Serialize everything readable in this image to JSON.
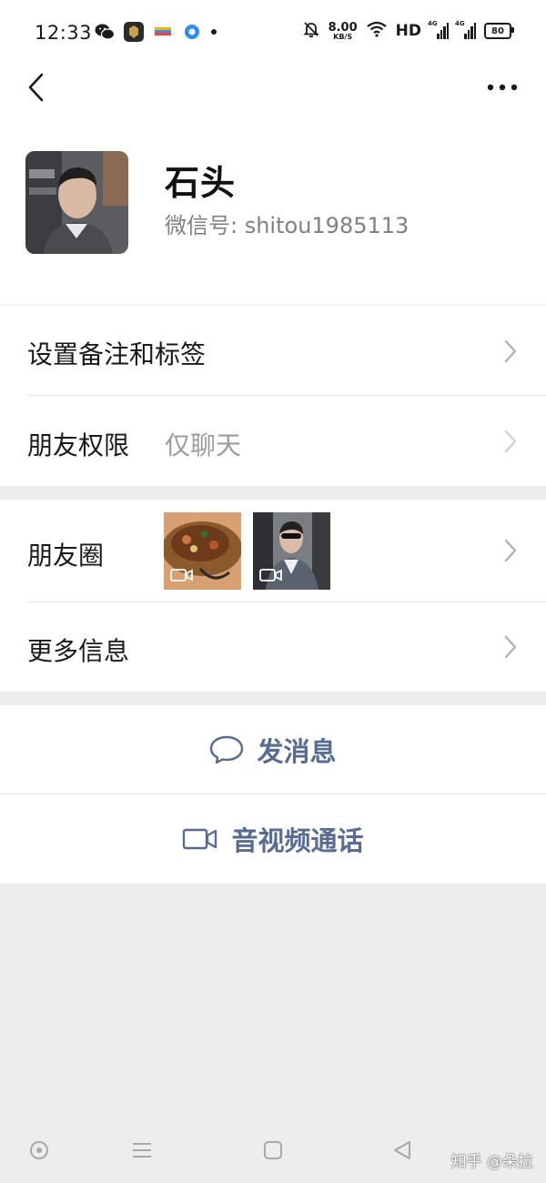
{
  "status_bar": {
    "time": "12:33",
    "net_speed_value": "8.00",
    "net_speed_unit": "KB/S",
    "hd_label": "HD",
    "sim1_label": "4G",
    "sim2_label": "4G",
    "battery": "80",
    "icons": [
      "wechat-icon",
      "app-icon",
      "wallet-icon",
      "browser-icon",
      "dot-icon",
      "bell-mute-icon",
      "wifi-icon",
      "signal-icon",
      "battery-icon"
    ]
  },
  "nav": {
    "back_icon": "chevron-left-icon",
    "more_icon": "more-dots-icon"
  },
  "profile": {
    "name": "石头",
    "wechat_id": "微信号: shitou1985113"
  },
  "settings": {
    "remark_label": "设置备注和标签",
    "permission_label": "朋友权限",
    "permission_value": "仅聊天"
  },
  "info": {
    "moments_label": "朋友圈",
    "more_info_label": "更多信息"
  },
  "actions": {
    "message_label": "发消息",
    "video_call_label": "音视频通话"
  },
  "watermark": "知乎 @朵拉",
  "colors": {
    "link": "#576b95",
    "background": "#ededed",
    "card": "#ffffff"
  }
}
